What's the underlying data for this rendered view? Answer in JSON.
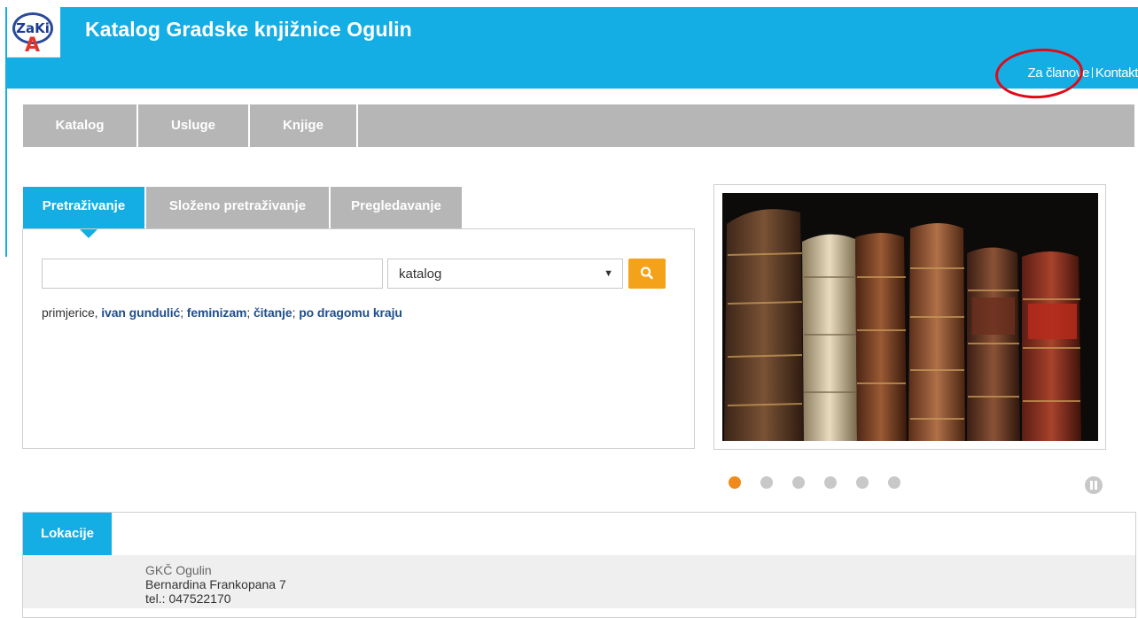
{
  "header": {
    "logo_text": "ZaKi",
    "logo_accent": "A",
    "title": "Katalog Gradske knjižnice Ogulin",
    "links": [
      "Za članove",
      "Kontakt"
    ],
    "brand_color": "#15aee4"
  },
  "navbar": {
    "items": [
      "Katalog",
      "Usluge",
      "Knjige"
    ]
  },
  "search": {
    "tabs": [
      "Pretraživanje",
      "Složeno pretraživanje",
      "Pregledavanje"
    ],
    "active_tab": "Pretraživanje",
    "query": "",
    "scope": "katalog",
    "button_icon": "search-icon",
    "examples_prefix": "primjerice,",
    "examples": [
      "ivan gundulić",
      "feminizam",
      "čitanje",
      "po dragomu kraju"
    ],
    "accent_color": "#f4a21a"
  },
  "slider": {
    "image": "old-books-on-shelf",
    "slide_count": 6,
    "active_slide": 1,
    "pause_icon": "pause-icon"
  },
  "locations": {
    "heading": "Lokacije",
    "name": "GKČ Ogulin",
    "address": "Bernardina Frankopana 7",
    "phone": "tel.: 047522170"
  },
  "annotation": {
    "color": "#e00a17"
  }
}
